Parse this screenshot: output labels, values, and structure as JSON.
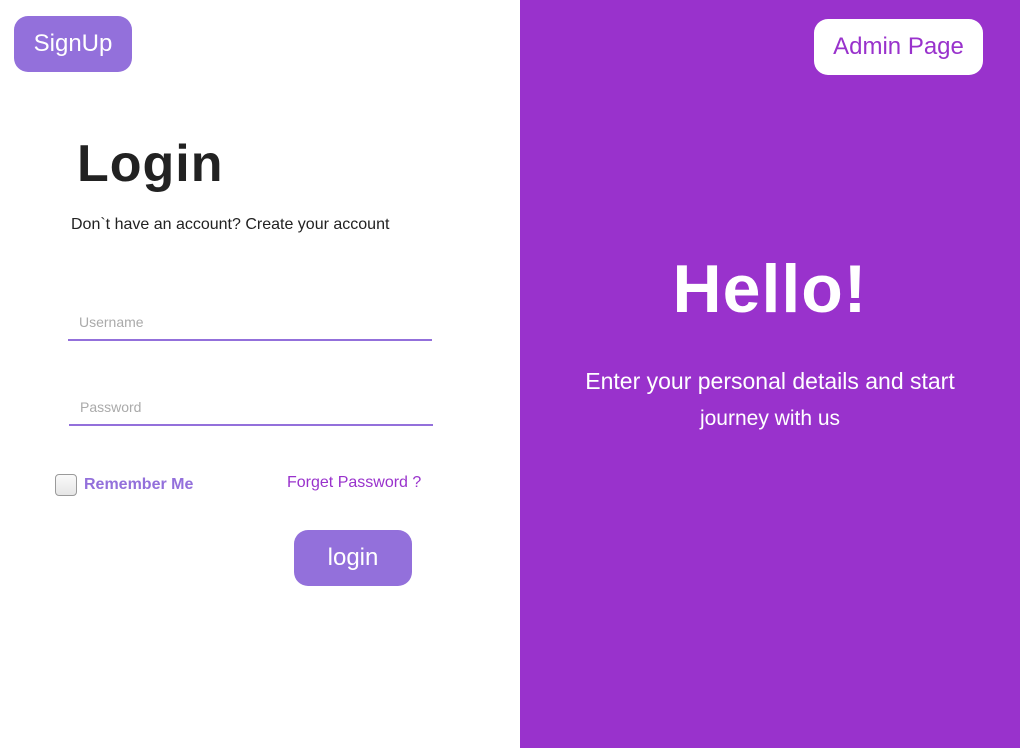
{
  "left": {
    "signup_label": "SignUp",
    "title": "Login",
    "subtitle": "Don`t have an account? Create your account",
    "username_placeholder": "Username",
    "password_placeholder": "Password",
    "remember_label": "Remember Me",
    "remember_checked": false,
    "forget_label": "Forget Password ?",
    "login_label": "login"
  },
  "right": {
    "admin_label": "Admin Page",
    "title": "Hello!",
    "text_line1": "Enter your personal details and start",
    "text_line2": "journey with us"
  },
  "colors": {
    "purple_panel": "#9932cc",
    "button_purple": "#9370db",
    "white": "#ffffff"
  }
}
